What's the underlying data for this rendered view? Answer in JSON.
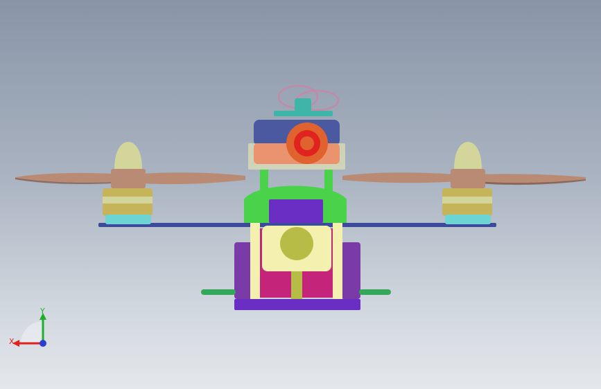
{
  "viewport": {
    "background_top": "#8994a6",
    "background_bottom": "#e4e7eb"
  },
  "model": {
    "colors": {
      "propeller": "#b98b74",
      "propeller_dark": "#6e4a3a",
      "motor_bell": "#d4d59a",
      "motor_gold": "#c5b45a",
      "motor_base": "#6ed3d3",
      "arm_plate": "#3b4a9a",
      "camera_body_blue": "#4b5aa0",
      "camera_body_red": "#e0231e",
      "camera_lens": "#e0622e",
      "mount_yellow": "#f3f0b0",
      "frame_green": "#4ad24a",
      "battery_purple": "#6a2ec4",
      "frame_magenta": "#c4257a",
      "side_purple": "#7a3aa8",
      "gimbal_olive": "#b7bc46",
      "antenna": "#c28aa8",
      "antenna_base": "#3fb5a8",
      "skid_green": "#34a85a"
    }
  },
  "triad": {
    "x_label": "X",
    "y_label": "Y",
    "x_color": "#e0201c",
    "y_color": "#1fae2a",
    "z_color": "#2a3cd6"
  }
}
